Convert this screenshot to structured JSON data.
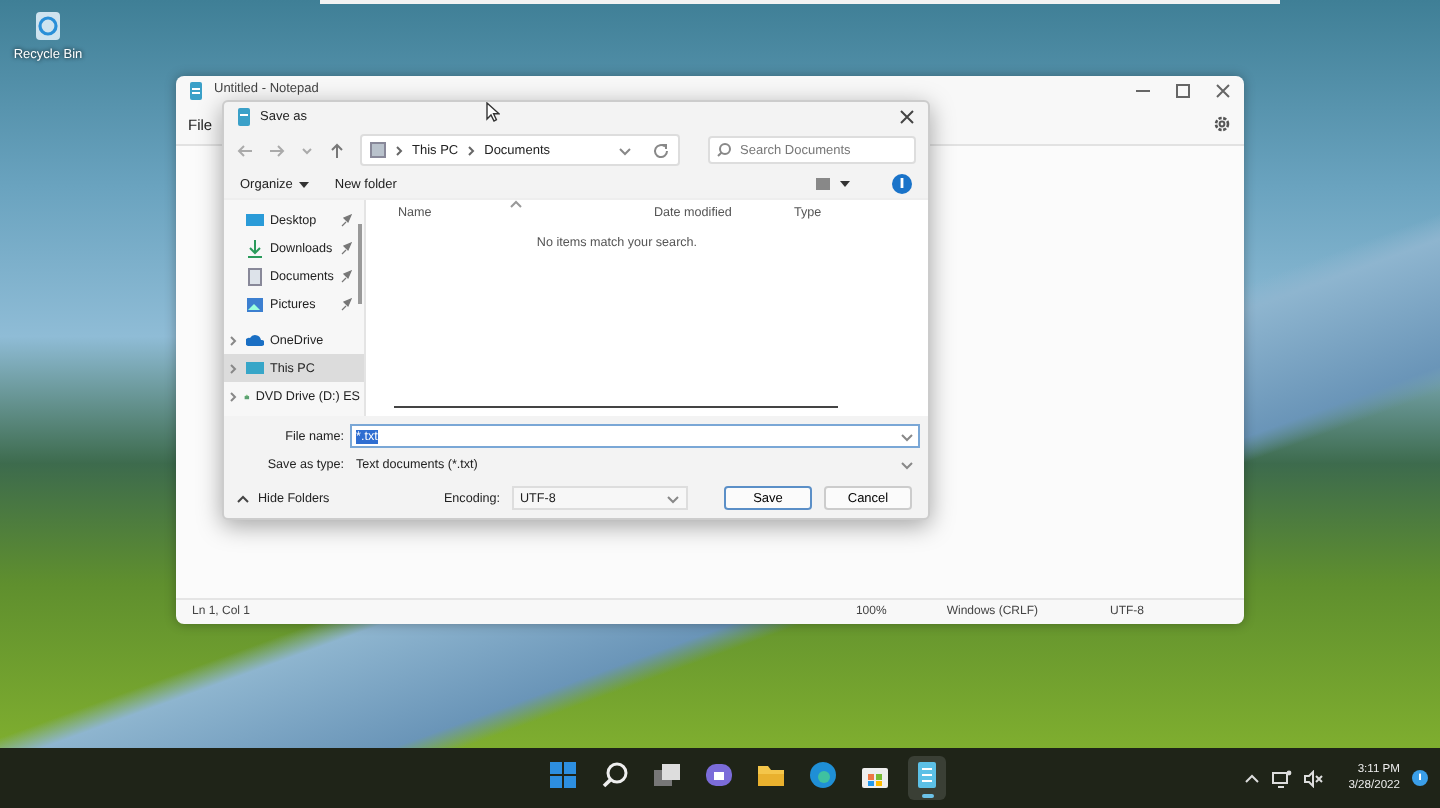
{
  "desktop": {
    "icons": [
      {
        "kind": "recycle-bin",
        "label": "Recycle Bin"
      }
    ]
  },
  "notepad": {
    "title": "Untitled - Notepad",
    "menu": [
      "File"
    ],
    "status_bar": [
      "Ln 1, Col 1",
      "100%",
      "Windows (CRLF)",
      "UTF-8"
    ]
  },
  "dialog": {
    "title": "Save as",
    "breadcrumb": [
      "This PC",
      "Documents"
    ],
    "search": {
      "placeholder": "Search Documents"
    },
    "toolbar": [
      "Organize",
      "New folder"
    ],
    "sidebar": {
      "items": [
        {
          "label": "Desktop",
          "kind": "desktop",
          "pinned": true,
          "expandable": false,
          "selected": false
        },
        {
          "label": "Downloads",
          "kind": "download",
          "pinned": true,
          "expandable": false,
          "selected": false
        },
        {
          "label": "Documents",
          "kind": "document",
          "pinned": true,
          "expandable": false,
          "selected": false
        },
        {
          "label": "Pictures",
          "kind": "picture",
          "pinned": true,
          "expandable": false,
          "selected": false
        },
        {
          "label": "OneDrive",
          "kind": "cloud",
          "pinned": false,
          "expandable": true,
          "selected": false
        },
        {
          "label": "This PC",
          "kind": "pc",
          "pinned": false,
          "expandable": true,
          "selected": true
        },
        {
          "label": "DVD Drive (D:) ES",
          "kind": "dvd",
          "pinned": false,
          "expandable": true,
          "selected": false
        }
      ]
    },
    "columns": [
      "Name",
      "Date modified",
      "Type"
    ],
    "empty_message": "No items match your search.",
    "file_name": {
      "label": "File name:",
      "value": "*.txt",
      "text_selected": true
    },
    "save_as_type": {
      "label": "Save as type:",
      "value": "Text documents (*.txt)"
    },
    "hide_folders": "Hide Folders",
    "encoding": {
      "label": "Encoding:",
      "value": "UTF-8"
    },
    "buttons": [
      {
        "label": "Save",
        "default": true
      },
      {
        "label": "Cancel",
        "default": false
      }
    ]
  },
  "taskbar": {
    "apps": [
      {
        "kind": "start",
        "active": false
      },
      {
        "kind": "search",
        "active": false
      },
      {
        "kind": "task-view",
        "active": false
      },
      {
        "kind": "chat",
        "active": false
      },
      {
        "kind": "folder",
        "active": false
      },
      {
        "kind": "browser",
        "active": false
      },
      {
        "kind": "store",
        "active": false
      },
      {
        "kind": "notepad",
        "active": true
      }
    ],
    "clock": {
      "time": "3:11 PM",
      "date": "3/28/2022"
    }
  }
}
